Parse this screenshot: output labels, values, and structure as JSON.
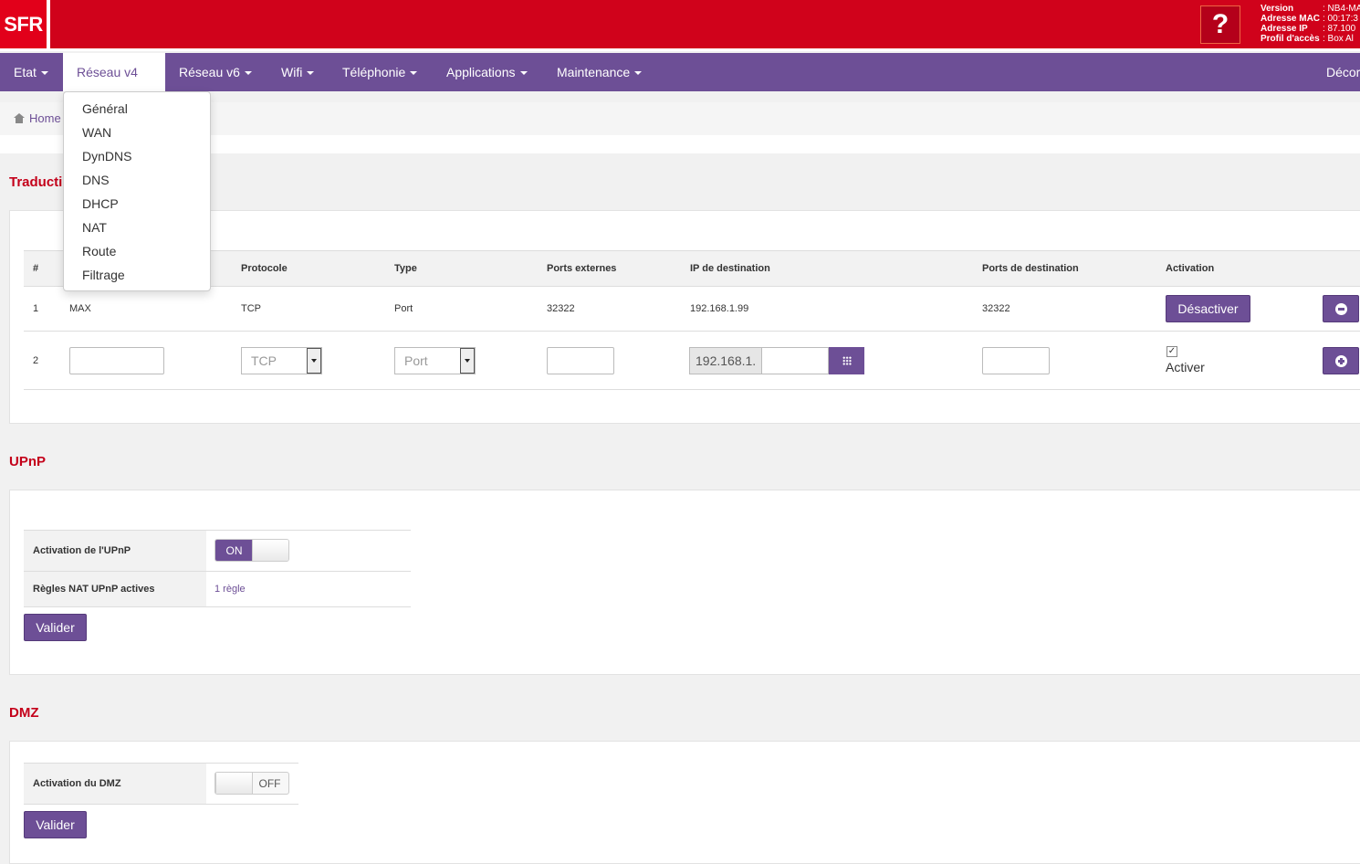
{
  "header": {
    "logo": "SFR",
    "help_label": "?",
    "info": [
      {
        "key": "Version",
        "value": ": NB4-MA"
      },
      {
        "key": "Adresse MAC",
        "value": ": 00:17:3"
      },
      {
        "key": "Adresse IP",
        "value": ": 87.100"
      },
      {
        "key": "Profil d'accès",
        "value": ": Box Al"
      }
    ]
  },
  "nav": {
    "items": [
      "Etat",
      "Réseau v4",
      "Réseau v6",
      "Wifi",
      "Téléphonie",
      "Applications",
      "Maintenance"
    ],
    "logout": "Décor"
  },
  "dropdown": {
    "items": [
      "Général",
      "WAN",
      "DynDNS",
      "DNS",
      "DHCP",
      "NAT",
      "Route",
      "Filtrage"
    ]
  },
  "breadcrumb": {
    "home": "Home"
  },
  "nat": {
    "title": "Traducti",
    "headers": [
      "#",
      "Protocole",
      "Type",
      "Ports externes",
      "IP de destination",
      "Ports de destination",
      "Activation"
    ],
    "row1": {
      "num": "1",
      "name": "MAX",
      "protocol": "TCP",
      "type": "Port",
      "ext_ports": "32322",
      "dest_ip": "192.168.1.99",
      "dest_ports": "32322",
      "action_label": "Désactiver"
    },
    "row2": {
      "num": "2",
      "protocol": "TCP",
      "type": "Port",
      "ip_prefix": "192.168.1.",
      "checkbox_mark": "✓",
      "activate_label": "Activer"
    }
  },
  "upnp": {
    "title": "UPnP",
    "activation_label": "Activation de l'UPnP",
    "toggle_state": "ON",
    "rules_label": "Règles NAT UPnP actives",
    "rules_value": "1 règle",
    "submit": "Valider"
  },
  "dmz": {
    "title": "DMZ",
    "activation_label": "Activation du DMZ",
    "toggle_state": "OFF",
    "submit": "Valider"
  },
  "colors": {
    "brand_red": "#d0021b",
    "nav_purple": "#6d4f96",
    "title_red": "#c4001a"
  }
}
